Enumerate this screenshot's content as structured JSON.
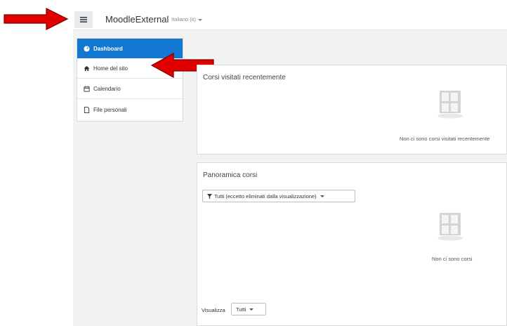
{
  "navbar": {
    "brand": "MoodleExternal",
    "language": "Italiano (it)"
  },
  "drawer": {
    "items": [
      {
        "label": "Dashboard",
        "icon": "dashboard-icon",
        "active": true
      },
      {
        "label": "Home del sito",
        "icon": "home-icon",
        "active": false
      },
      {
        "label": "Calendario",
        "icon": "calendar-icon",
        "active": false
      },
      {
        "label": "File personali",
        "icon": "file-icon",
        "active": false
      }
    ]
  },
  "recent": {
    "title": "Corsi visitati recentemente",
    "empty_text": "Non ci sono corsi visitati recentemente"
  },
  "overview": {
    "title": "Panoramica corsi",
    "filter_label": "Tutti (eccetto eliminati dalla visualizzazione)",
    "empty_text": "Non ci sono corsi",
    "show_label": "Visualizza",
    "show_value": "Tutti"
  },
  "colors": {
    "accent": "#1177d1",
    "annotation_arrow": "#e00000"
  }
}
